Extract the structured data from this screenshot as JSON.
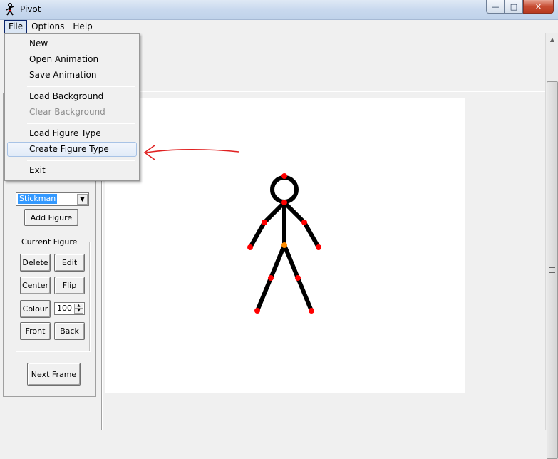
{
  "window": {
    "title": "Pivot",
    "minimize_icon": "minimize-icon",
    "maximize_icon": "maximize-icon",
    "close_icon": "close-icon"
  },
  "menubar": {
    "items": [
      "File",
      "Options",
      "Help"
    ]
  },
  "file_menu": {
    "items": [
      {
        "label": "New",
        "enabled": true
      },
      {
        "label": "Open Animation",
        "enabled": true
      },
      {
        "label": "Save Animation",
        "enabled": true
      },
      {
        "label": "Load Background",
        "enabled": true
      },
      {
        "label": "Clear Background",
        "enabled": false
      },
      {
        "label": "Load Figure Type",
        "enabled": true
      },
      {
        "label": "Create Figure Type",
        "enabled": true,
        "highlighted": true
      },
      {
        "label": "Exit",
        "enabled": true
      }
    ]
  },
  "left_panel": {
    "figure_type_selected": "Stickman",
    "add_figure_label": "Add Figure",
    "current_figure_group": "Current Figure",
    "delete_label": "Delete",
    "edit_label": "Edit",
    "center_label": "Center",
    "flip_label": "Flip",
    "colour_label": "Colour",
    "colour_value": "100",
    "front_label": "Front",
    "back_label": "Back",
    "next_frame_label": "Next Frame"
  },
  "canvas": {
    "background": "#ffffff",
    "figure": {
      "name": "Stickman",
      "line_color": "#000000",
      "joint_color": "#ff0000",
      "origin_color": "#ff8c00"
    }
  },
  "annotation": {
    "color": "#e02020",
    "type": "arrow-pointing-left"
  }
}
